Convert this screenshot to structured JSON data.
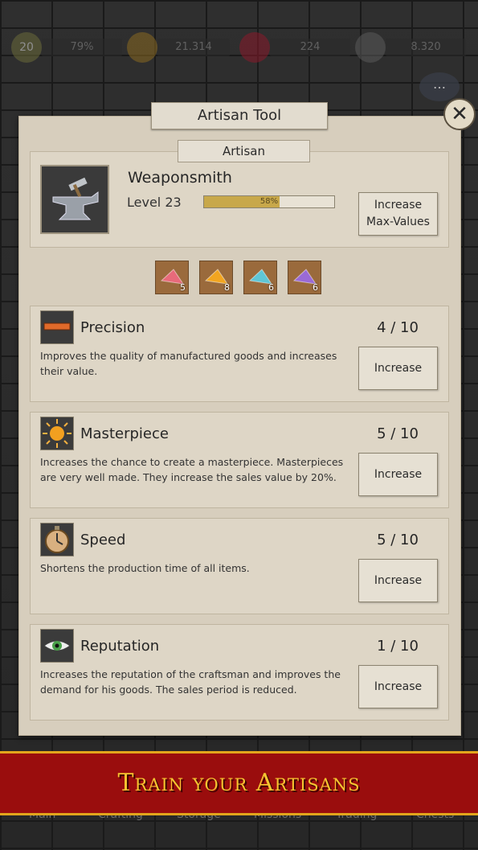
{
  "topbar": {
    "level": "20",
    "progress": "79%",
    "gold": "21.314",
    "rubies": "224",
    "coins": "8.320"
  },
  "dialog": {
    "title": "Artisan Tool",
    "close": "✕",
    "section": "Artisan",
    "artisan": {
      "name": "Weaponsmith",
      "level": "Level 23",
      "progress_label": "58%",
      "progress": 0.58,
      "button": "Increase Max-Values"
    },
    "gems": [
      {
        "color": "#e86a7a",
        "count": "5"
      },
      {
        "color": "#f2a520",
        "count": "8"
      },
      {
        "color": "#5fc6d6",
        "count": "6"
      },
      {
        "color": "#9a6ad6",
        "count": "6"
      }
    ],
    "skills": [
      {
        "title": "Precision",
        "count": "4 / 10",
        "desc": "Improves the quality of manufactured goods and increases their value.",
        "button": "Increase",
        "icon": "ruler-icon"
      },
      {
        "title": "Masterpiece",
        "count": "5 / 10",
        "desc": "Increases the chance to create a masterpiece. Masterpieces are very well made. They increase the sales value by 20%.",
        "button": "Increase",
        "icon": "sun-icon"
      },
      {
        "title": "Speed",
        "count": "5 / 10",
        "desc": "Shortens the production time of all items.",
        "button": "Increase",
        "icon": "stopwatch-icon"
      },
      {
        "title": "Reputation",
        "count": "1 / 10",
        "desc": "Increases the reputation of the craftsman and improves the demand for his goods. The sales period is reduced.",
        "button": "Increase",
        "icon": "eye-icon"
      }
    ]
  },
  "banner": "Train your Artisans",
  "bottomnav": [
    "Main",
    "Crafting",
    "Storage",
    "Missions",
    "Trading",
    "Chests"
  ]
}
